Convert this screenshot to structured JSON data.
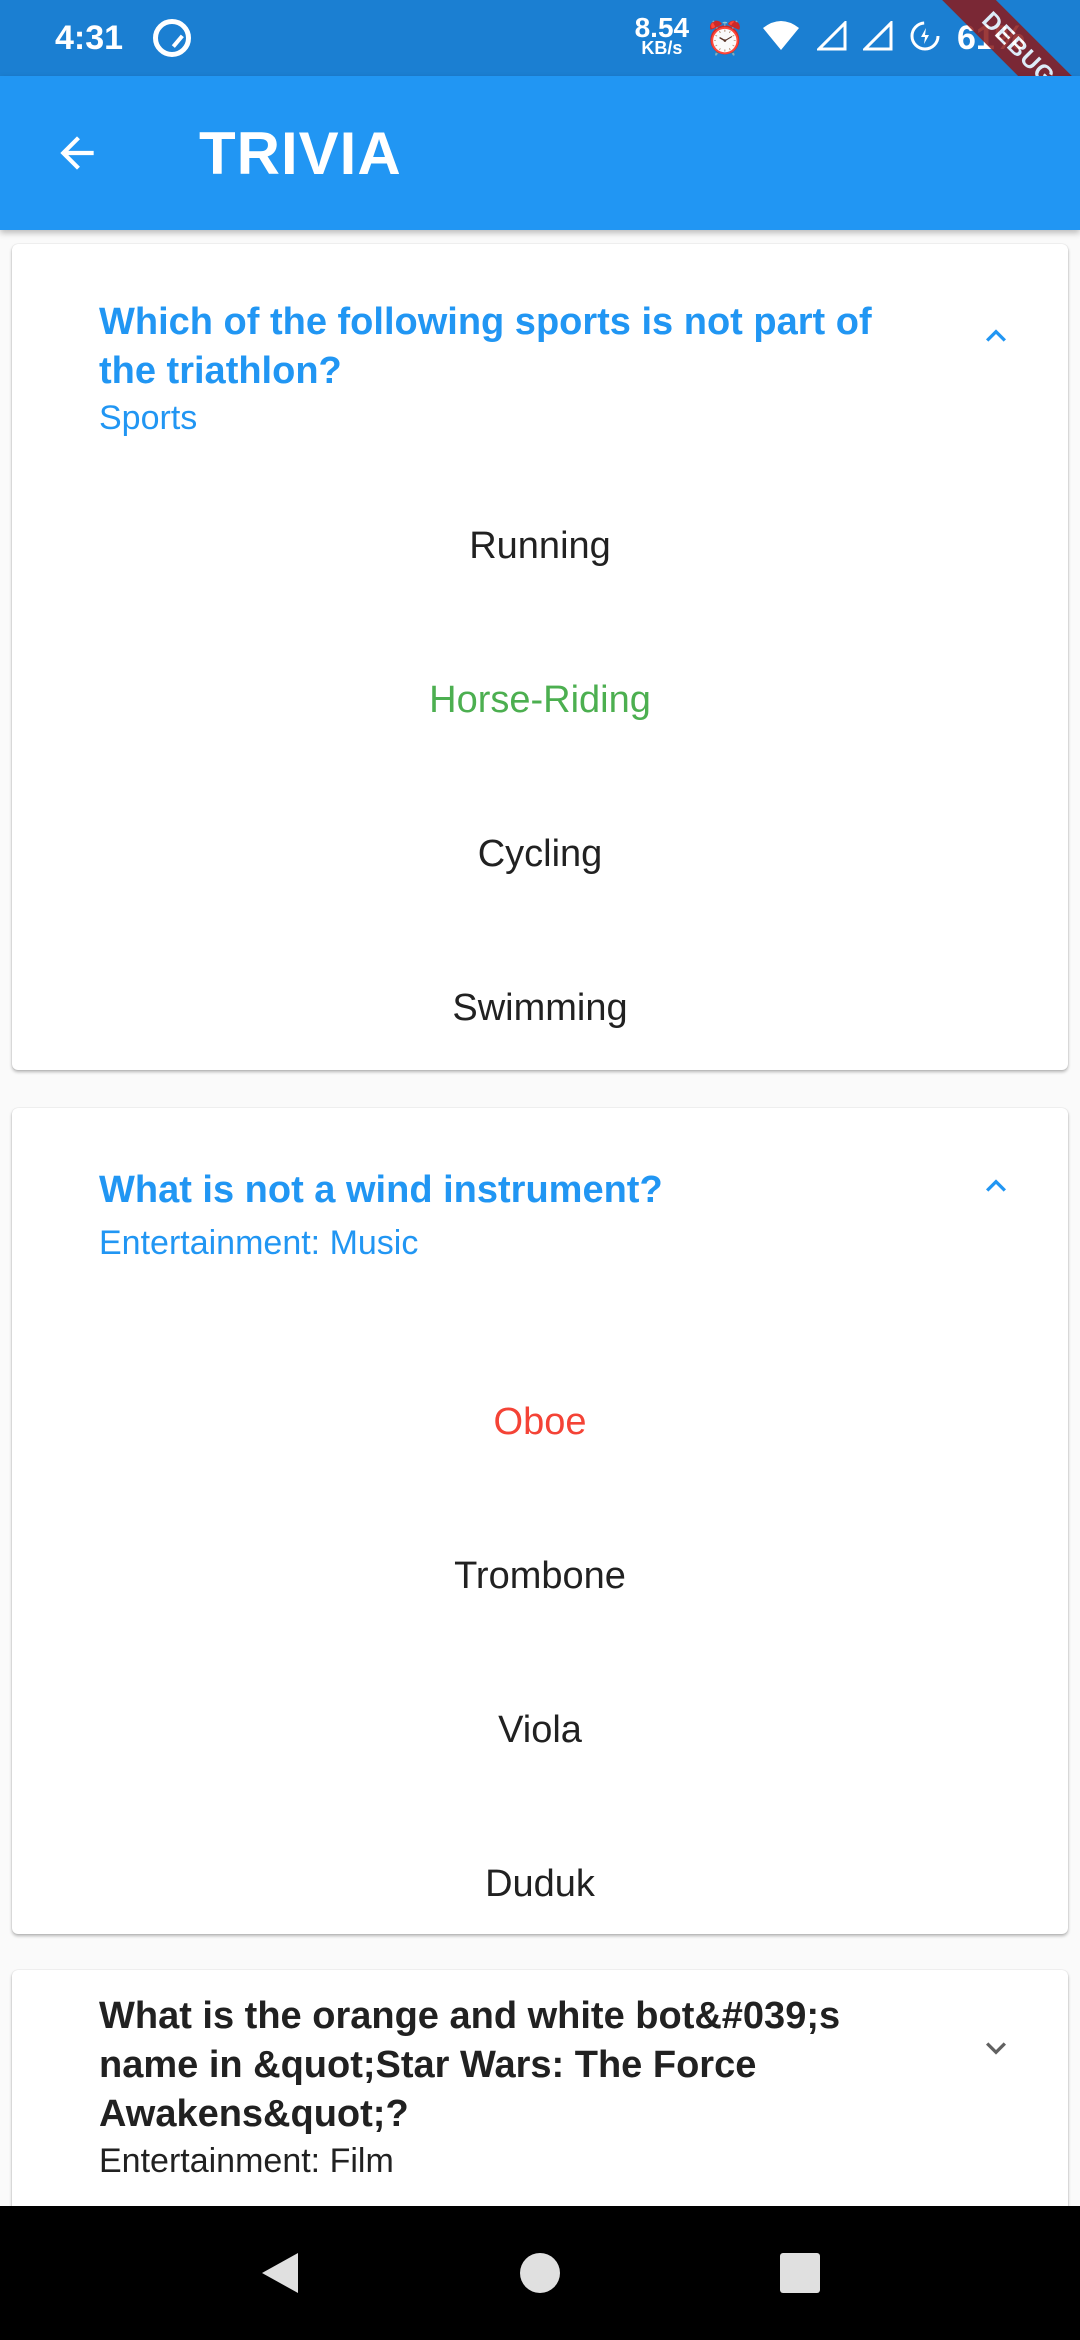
{
  "status_bar": {
    "time": "4:31",
    "net_speed_value": "8.54",
    "net_speed_unit": "KB/s",
    "battery": "61%"
  },
  "debug_banner": "DEBUG",
  "app_bar": {
    "title": "TRIVIA",
    "back_icon": "arrow-back-icon"
  },
  "colors": {
    "primary": "#2196f3",
    "correct": "#4caf50",
    "wrong": "#f44336",
    "text": "#212121"
  },
  "cards": [
    {
      "question": "Which of the following sports is not part of the triathlon?",
      "category": "Sports",
      "expanded": true,
      "answers": [
        {
          "text": "Running",
          "state": "neutral"
        },
        {
          "text": "Horse-Riding",
          "state": "correct"
        },
        {
          "text": "Cycling",
          "state": "neutral"
        },
        {
          "text": "Swimming",
          "state": "neutral"
        }
      ]
    },
    {
      "question": "What is not a wind instrument?",
      "category": "Entertainment: Music",
      "expanded": true,
      "answers": [
        {
          "text": "Oboe",
          "state": "wrong"
        },
        {
          "text": "Trombone",
          "state": "neutral"
        },
        {
          "text": "Viola",
          "state": "neutral"
        },
        {
          "text": "Duduk",
          "state": "neutral"
        }
      ]
    },
    {
      "question": "What is the orange and white bot&#039;s name in &quot;Star Wars: The Force Awakens&quot;?",
      "category": "Entertainment: Film",
      "expanded": false,
      "answers": []
    }
  ]
}
